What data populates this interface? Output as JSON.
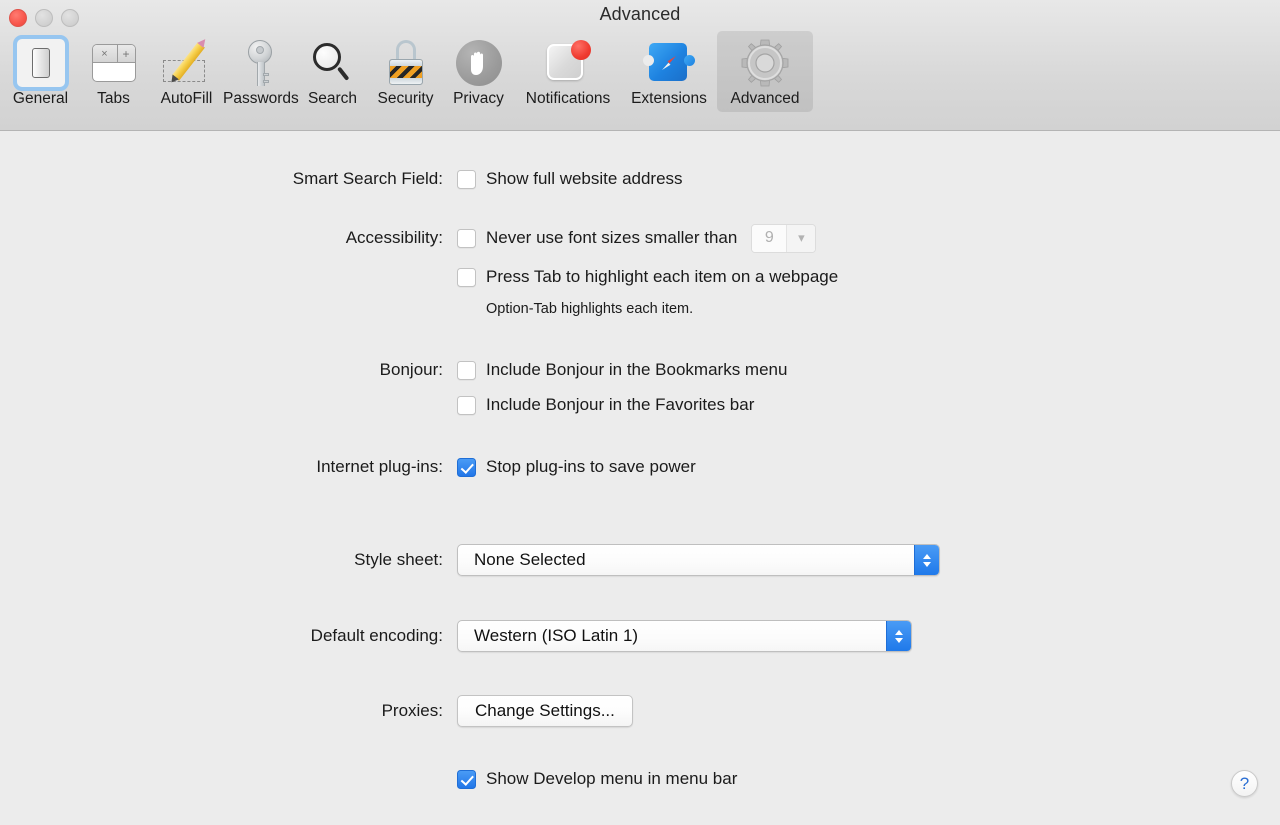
{
  "window": {
    "title": "Advanced",
    "traffic_lights": [
      "close",
      "minimize",
      "zoom"
    ]
  },
  "toolbar": {
    "items": [
      {
        "label": "General",
        "icon": "general-icon",
        "state": "focused"
      },
      {
        "label": "Tabs",
        "icon": "tabs-icon",
        "state": "normal"
      },
      {
        "label": "AutoFill",
        "icon": "autofill-icon",
        "state": "normal"
      },
      {
        "label": "Passwords",
        "icon": "key-icon",
        "state": "normal"
      },
      {
        "label": "Search",
        "icon": "magnifier-icon",
        "state": "normal"
      },
      {
        "label": "Security",
        "icon": "lock-icon",
        "state": "normal"
      },
      {
        "label": "Privacy",
        "icon": "hand-icon",
        "state": "normal"
      },
      {
        "label": "Notifications",
        "icon": "notification-icon",
        "state": "normal"
      },
      {
        "label": "Extensions",
        "icon": "puzzle-compass-icon",
        "state": "normal"
      },
      {
        "label": "Advanced",
        "icon": "gear-icon",
        "state": "selected"
      }
    ]
  },
  "settings": {
    "smart_search": {
      "label": "Smart Search Field:",
      "show_full_address": {
        "text": "Show full website address",
        "checked": false
      }
    },
    "accessibility": {
      "label": "Accessibility:",
      "min_font": {
        "text": "Never use font sizes smaller than",
        "checked": false
      },
      "min_font_value": "9",
      "press_tab": {
        "text": "Press Tab to highlight each item on a webpage",
        "checked": false
      },
      "hint": "Option-Tab highlights each item."
    },
    "bonjour": {
      "label": "Bonjour:",
      "bookmarks_menu": {
        "text": "Include Bonjour in the Bookmarks menu",
        "checked": false
      },
      "favorites_bar": {
        "text": "Include Bonjour in the Favorites bar",
        "checked": false
      }
    },
    "plugins": {
      "label": "Internet plug-ins:",
      "stop_plugins": {
        "text": "Stop plug-ins to save power",
        "checked": true
      }
    },
    "style_sheet": {
      "label": "Style sheet:",
      "value": "None Selected"
    },
    "encoding": {
      "label": "Default encoding:",
      "value": "Western (ISO Latin 1)"
    },
    "proxies": {
      "label": "Proxies:",
      "button": "Change Settings..."
    },
    "develop_menu": {
      "text": "Show Develop menu in menu bar",
      "checked": true
    }
  },
  "help": {
    "glyph": "?"
  },
  "colors": {
    "accent_blue": "#2176e8",
    "window_bg": "#ececec",
    "toolbar_bg": "#d8d8d8",
    "text": "#1b1b1b"
  }
}
